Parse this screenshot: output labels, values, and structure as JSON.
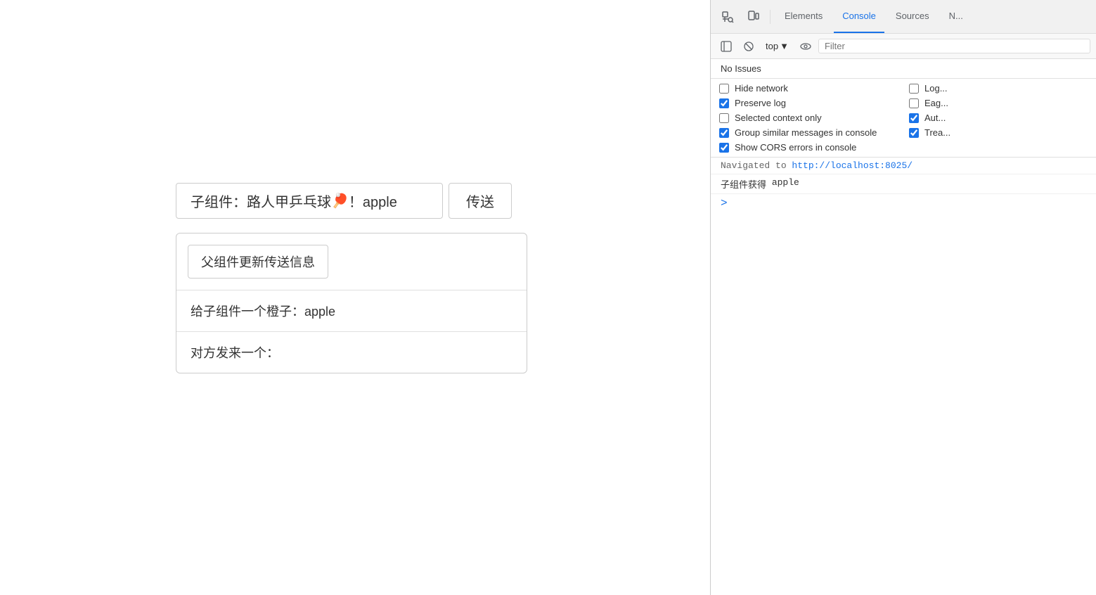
{
  "page": {
    "child_label": "子组件：",
    "child_value": "路人甲乒乓球",
    "child_emoji": "🏓",
    "child_extra": "！apple",
    "send_btn": "传送",
    "parent": {
      "update_btn": "父组件更新传送信息",
      "orange_label": "给子组件一个橙子：apple",
      "receive_label": "对方发来一个："
    }
  },
  "devtools": {
    "tabs": [
      {
        "label": "Elements",
        "active": false
      },
      {
        "label": "Console",
        "active": true
      },
      {
        "label": "Sources",
        "active": false
      },
      {
        "label": "N...",
        "active": false
      }
    ],
    "toolbar": {
      "top_label": "top",
      "filter_placeholder": "Filter"
    },
    "no_issues": "No Issues",
    "options": [
      {
        "id": "hide-network",
        "label": "Hide network",
        "checked": false,
        "col": 1
      },
      {
        "id": "log-xhr",
        "label": "Log...",
        "checked": false,
        "col": 2
      },
      {
        "id": "preserve-log",
        "label": "Preserve log",
        "checked": true,
        "col": 1
      },
      {
        "id": "eager-eval",
        "label": "Eag...",
        "checked": false,
        "col": 2
      },
      {
        "id": "selected-context",
        "label": "Selected context only",
        "checked": false,
        "col": 1
      },
      {
        "id": "autocomplete",
        "label": "Aut...",
        "checked": true,
        "col": 2
      },
      {
        "id": "group-similar",
        "label": "Group similar messages in console",
        "checked": true,
        "col": 1
      },
      {
        "id": "treat-evals",
        "label": "Trea...",
        "checked": true,
        "col": 2
      },
      {
        "id": "show-cors",
        "label": "Show CORS errors in console",
        "checked": true,
        "col": 1
      }
    ],
    "console_entries": [
      {
        "type": "navigate",
        "text": "Navigated to ",
        "link": "http://localhost:8025/"
      },
      {
        "type": "log",
        "prefix": "子组件获得",
        "value": " apple"
      }
    ]
  }
}
